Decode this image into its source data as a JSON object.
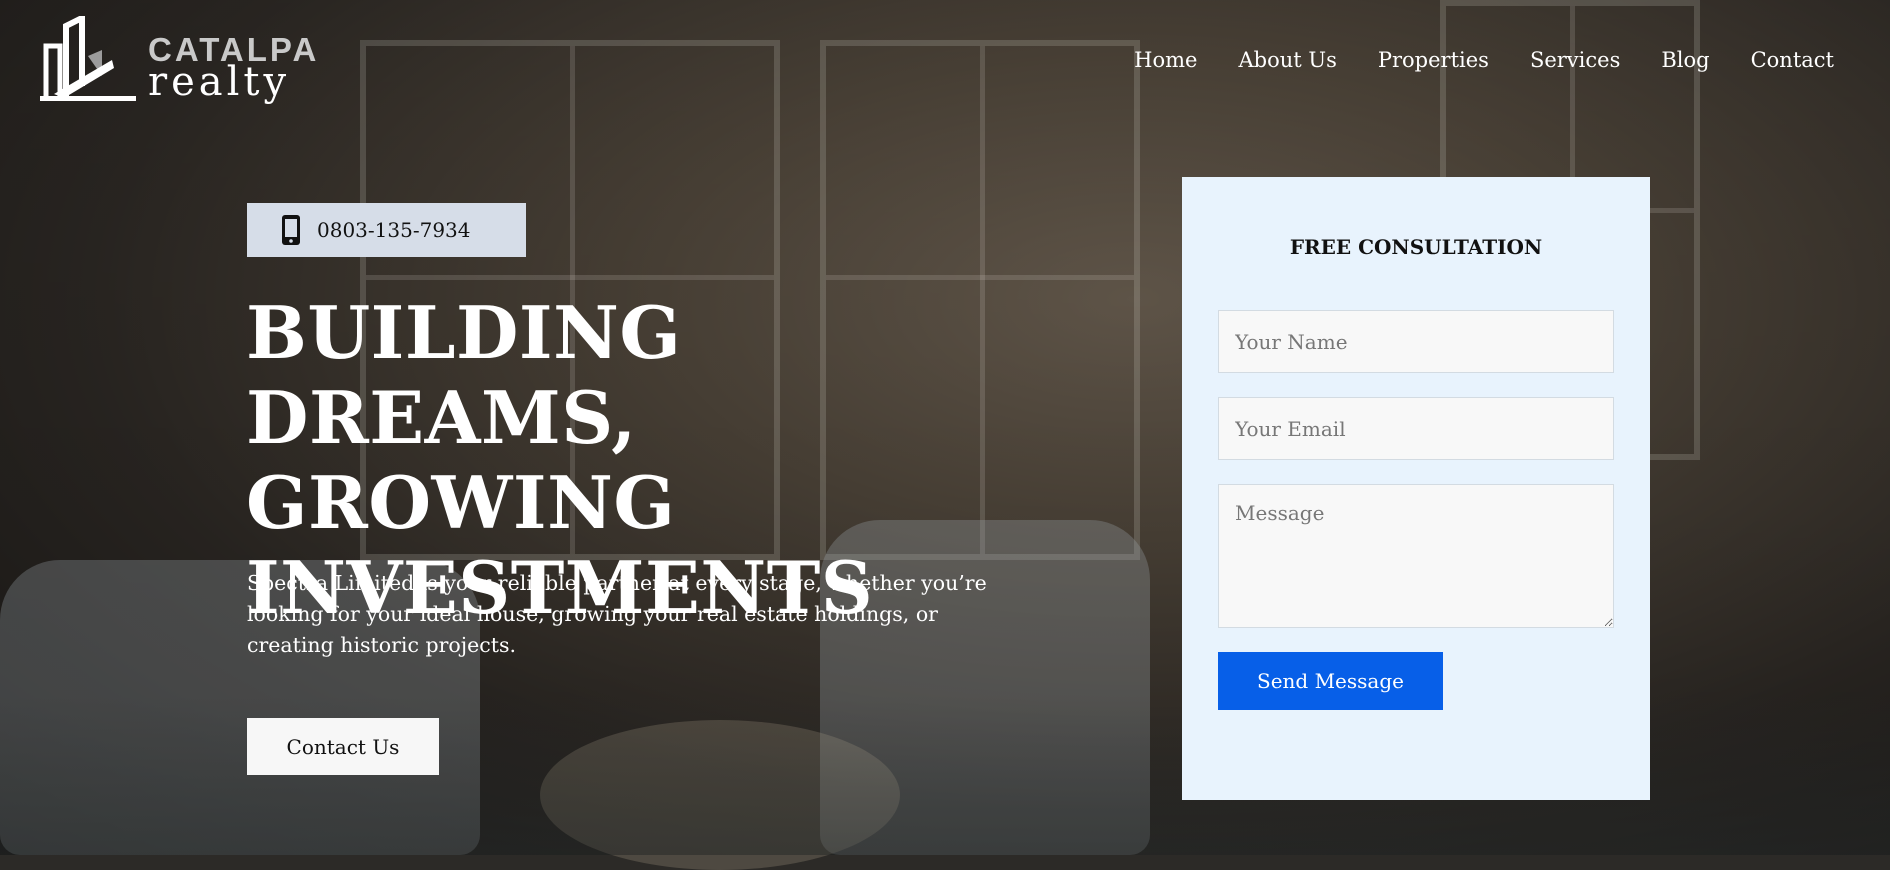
{
  "brand": {
    "line1": "CATALPA",
    "line2": "realty"
  },
  "nav": {
    "items": [
      {
        "label": "Home"
      },
      {
        "label": "About Us"
      },
      {
        "label": "Properties"
      },
      {
        "label": "Services"
      },
      {
        "label": "Blog"
      },
      {
        "label": "Contact"
      }
    ]
  },
  "hero": {
    "phone": "0803-135-7934",
    "phone_icon": "mobile-phone-icon",
    "headline": [
      "BUILDING DREAMS,",
      "GROWING",
      "INVESTMENTS"
    ],
    "intro": "Spectra Limited is your reliable partner at every stage, whether you’re looking for your ideal house, growing your real estate holdings, or creating historic projects.",
    "cta_label": "Contact Us"
  },
  "form": {
    "title": "FREE CONSULTATION",
    "name_placeholder": "Your Name",
    "email_placeholder": "Your Email",
    "message_placeholder": "Message",
    "submit_label": "Send Message"
  },
  "colors": {
    "phone_badge": "#d6dde8",
    "form_card": "#e8f3fd",
    "primary_button": "#075fe8"
  }
}
